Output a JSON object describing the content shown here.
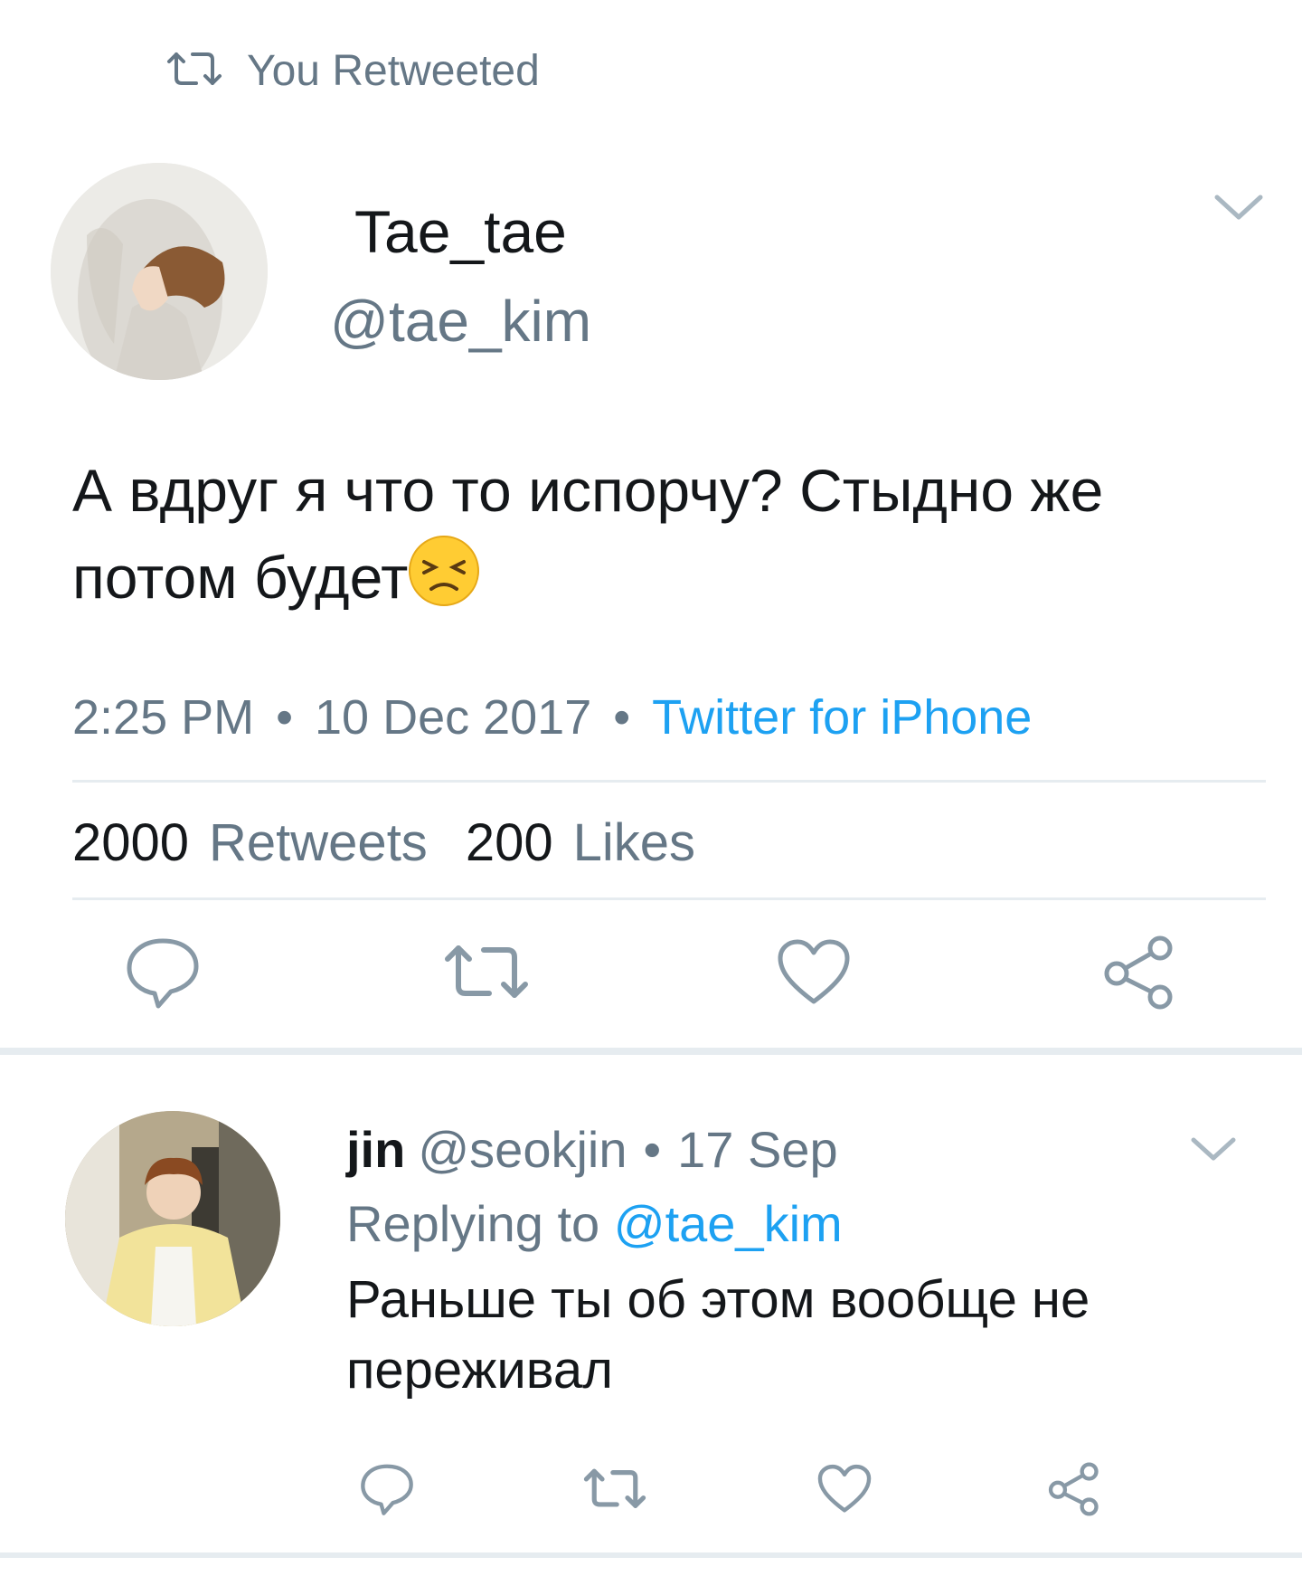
{
  "retweet_header": {
    "label": "You Retweeted",
    "icon": "retweet-icon"
  },
  "tweet": {
    "author_name": "Tae_tae",
    "author_handle": "@tae_kim",
    "text": "А вдруг я что то испорчу? Стыдно же потом будет",
    "emoji": "😣",
    "time": "2:25 PM",
    "date": "10 Dec 2017",
    "source": "Twitter for iPhone",
    "separator": "•",
    "retweets_count": "2000",
    "retweets_label": "Retweets",
    "likes_count": "200",
    "likes_label": "Likes"
  },
  "reply": {
    "author_name": "jin",
    "author_handle": "@seokjin",
    "separator": "•",
    "date": "17 Sep",
    "replying_to_prefix": "Replying to",
    "replying_to_handle": "@tae_kim",
    "text": "Раньше ты об этом вообще не переживал"
  },
  "actions": [
    "reply-icon",
    "retweet-icon",
    "like-icon",
    "share-icon"
  ],
  "colors": {
    "link": "#1da1f2",
    "secondary": "#657786",
    "icon": "#8899a6",
    "divider": "#e6ecf0"
  }
}
